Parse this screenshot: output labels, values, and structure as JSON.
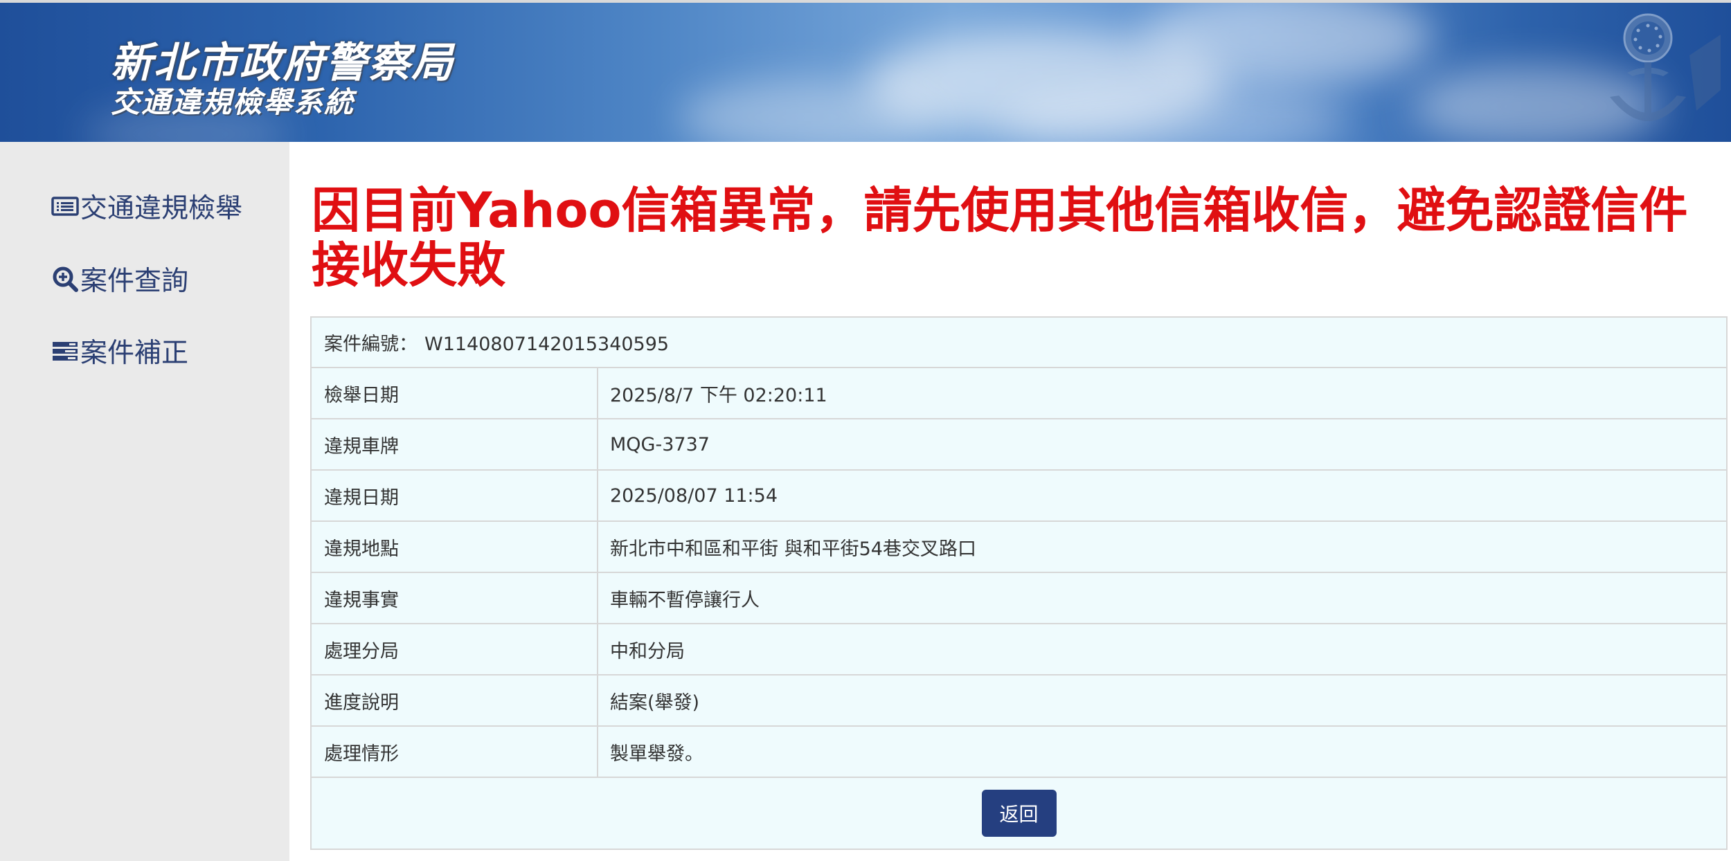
{
  "header": {
    "title": "新北市政府警察局",
    "subtitle": "交通違規檢舉系統"
  },
  "sidebar": {
    "items": [
      {
        "label": "交通違規檢舉",
        "icon": "list-icon"
      },
      {
        "label": "案件查詢",
        "icon": "search-icon"
      },
      {
        "label": "案件補正",
        "icon": "edit-list-icon"
      }
    ]
  },
  "notice": "因目前Yahoo信箱異常，請先使用其他信箱收信，避免認證信件接收失敗",
  "case": {
    "id_label": "案件編號：",
    "id_value": "W1140807142015340595",
    "rows": [
      {
        "label": "檢舉日期",
        "value": "2025/8/7 下午 02:20:11"
      },
      {
        "label": "違規車牌",
        "value": "MQG-3737"
      },
      {
        "label": "違規日期",
        "value": "2025/08/07 11:54"
      },
      {
        "label": "違規地點",
        "value": "新北市中和區和平街 與和平街54巷交叉路口"
      },
      {
        "label": "違規事實",
        "value": "車輛不暫停讓行人"
      },
      {
        "label": "處理分局",
        "value": "中和分局"
      },
      {
        "label": "進度說明",
        "value": "結案(舉發)"
      },
      {
        "label": "處理情形",
        "value": "製單舉發。"
      }
    ]
  },
  "actions": {
    "back_label": "返回"
  },
  "colors": {
    "notice": "#e00f12",
    "nav_text": "#2b3f73",
    "button_bg": "#253f80",
    "table_bg": "#effbfd",
    "sidebar_bg": "#eaeaea"
  }
}
